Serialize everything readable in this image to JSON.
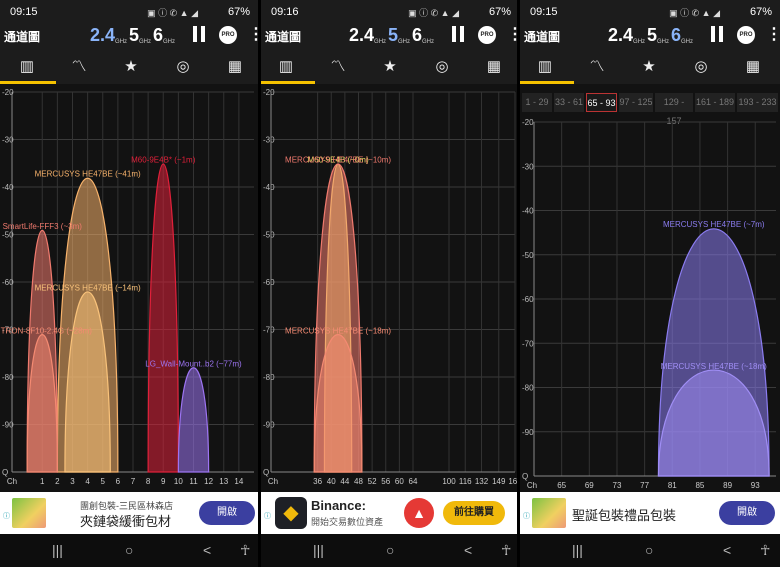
{
  "panels": [
    {
      "status": {
        "time": "09:15",
        "battery": "67%",
        "icons": "▣ ⓘ ✆ ▲ ◢"
      },
      "title": "通道圖",
      "bands": [
        {
          "label": "2.4",
          "unit": "GHz",
          "active": true
        },
        {
          "label": "5",
          "unit": "GHz",
          "active": false
        },
        {
          "label": "6",
          "unit": "GHz",
          "active": false
        }
      ],
      "pro": "PRO",
      "chart_data": {
        "type": "area",
        "x_ticks": [
          "Ch",
          "1",
          "2",
          "3",
          "4",
          "5",
          "6",
          "7",
          "8",
          "9",
          "10",
          "11",
          "12",
          "13",
          "14"
        ],
        "y_ticks": [
          "-20",
          "-30",
          "-40",
          "-50",
          "-60",
          "-70",
          "-80",
          "-90",
          "Q"
        ],
        "ylim": [
          -100,
          -20
        ],
        "xlim": [
          -1,
          15
        ],
        "series": [
          {
            "name": "MERCUSYS HE47BE (~41m)",
            "center": 4,
            "width": 4,
            "peak": -38,
            "color": "#f7b26b"
          },
          {
            "name": "M60-9E4B* (~1m)",
            "center": 9,
            "width": 2,
            "peak": -35,
            "color": "#e0203a"
          },
          {
            "name": "SmartLife-FFF3 (~3m)",
            "center": 1,
            "width": 2,
            "peak": -49,
            "color": "#f07a6e"
          },
          {
            "name": "MERCUSYS HE47BE (~14m)",
            "center": 4,
            "width": 3,
            "peak": -62,
            "color": "#f9c27a"
          },
          {
            "name": "HITRON-8F10-2.4G (~28m)",
            "center": 1,
            "width": 2,
            "peak": -71,
            "color": "#f48a72"
          },
          {
            "name": "LG_Wall-Mount..b2 (~77m)",
            "center": 11,
            "width": 2,
            "peak": -78,
            "color": "#9d74f2"
          }
        ]
      },
      "ad": {
        "small": "團創包裝-三民區林森店",
        "big": "夾鏈袋緩衝包材",
        "button": "開啟"
      }
    },
    {
      "status": {
        "time": "09:16",
        "battery": "67%",
        "icons": "▣ ⓘ ✆ ▲ ◢"
      },
      "title": "通道圖",
      "bands": [
        {
          "label": "2.4",
          "unit": "GHz",
          "active": false
        },
        {
          "label": "5",
          "unit": "GHz",
          "active": true
        },
        {
          "label": "6",
          "unit": "GHz",
          "active": false
        }
      ],
      "pro": "PRO",
      "chart_data": {
        "type": "area",
        "x_ticks": [
          "Ch",
          "36",
          "40",
          "44",
          "48",
          "52",
          "56",
          "60",
          "64",
          "100",
          "116",
          "132",
          "149",
          "165"
        ],
        "y_ticks": [
          "-20",
          "-30",
          "-40",
          "-50",
          "-60",
          "-70",
          "-80",
          "-90",
          "Q"
        ],
        "ylim": [
          -100,
          -20
        ],
        "series": [
          {
            "name": "M60-9E4B (~0m)",
            "center": 42,
            "width": 8,
            "peak": -35,
            "color": "#f7e36b"
          },
          {
            "name": "MERCUSYS HE47BE (~10m)",
            "center": 42,
            "width": 14,
            "peak": -35,
            "color": "#f07a6e"
          },
          {
            "name": "MERCUSYS HE47BE (~18m)",
            "center": 42,
            "width": 14,
            "peak": -71,
            "color": "#f48a72"
          }
        ]
      },
      "ad": {
        "brand": "Binance:",
        "sub": "開始交易數位資產",
        "button": "前往購買"
      }
    },
    {
      "status": {
        "time": "09:15",
        "battery": "67%",
        "icons": "▣ ⓘ ✆ ▲ ◢"
      },
      "title": "通道圖",
      "bands": [
        {
          "label": "2.4",
          "unit": "GHz",
          "active": false
        },
        {
          "label": "5",
          "unit": "GHz",
          "active": false
        },
        {
          "label": "6",
          "unit": "GHz",
          "active": true
        }
      ],
      "pro": "PRO",
      "channel_groups": [
        "1 - 29",
        "33 - 61",
        "65 - 93",
        "97 - 125",
        "129 - 157",
        "161 - 189",
        "193 - 233"
      ],
      "selected_group": "65 - 93",
      "chart_data": {
        "type": "area",
        "x_ticks": [
          "Ch",
          "65",
          "69",
          "73",
          "77",
          "81",
          "85",
          "89",
          "93"
        ],
        "y_ticks": [
          "-20",
          "-30",
          "-40",
          "-50",
          "-60",
          "-70",
          "-80",
          "-90",
          "Q"
        ],
        "ylim": [
          -100,
          -20
        ],
        "series": [
          {
            "name": "MERCUSYS HE47BE (~7m)",
            "center": 87,
            "width": 16,
            "peak": -44,
            "color": "#8b7cf0"
          },
          {
            "name": "MERCUSYS HE47BE (~18m)",
            "center": 87,
            "width": 16,
            "peak": -76,
            "color": "#a08ef5"
          }
        ]
      },
      "ad": {
        "big": "聖誕包裝禮品包裝",
        "button": "開啟"
      }
    }
  ],
  "nav": {
    "recents": "|||",
    "home": "○",
    "back": "<",
    "a11y": "☥"
  }
}
